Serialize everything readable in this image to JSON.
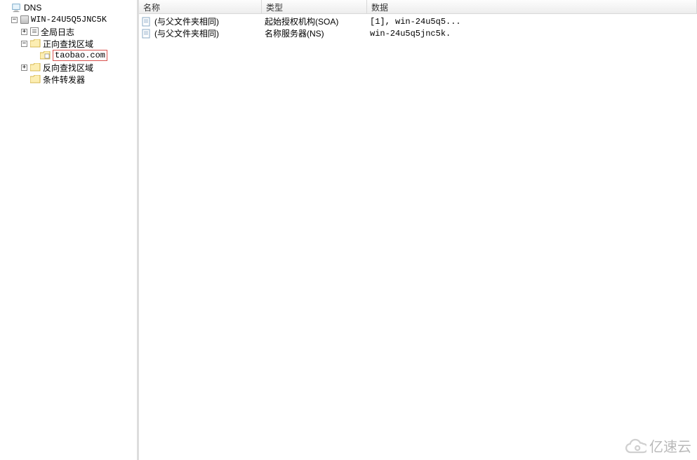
{
  "tree": {
    "root": "DNS",
    "server": "WIN-24U5Q5JNC5K",
    "global_log": "全局日志",
    "fwd_zone": "正向查找区域",
    "zone_taobao": "taobao.com",
    "rev_zone": "反向查找区域",
    "cond_fwd": "条件转发器"
  },
  "columns": {
    "name": "名称",
    "type": "类型",
    "data": "数据"
  },
  "records": [
    {
      "name": "(与父文件夹相同)",
      "type": "起始授权机构(SOA)",
      "data": "[1], win-24u5q5..."
    },
    {
      "name": "(与父文件夹相同)",
      "type": "名称服务器(NS)",
      "data": "win-24u5q5jnc5k."
    }
  ],
  "watermark": "亿速云"
}
